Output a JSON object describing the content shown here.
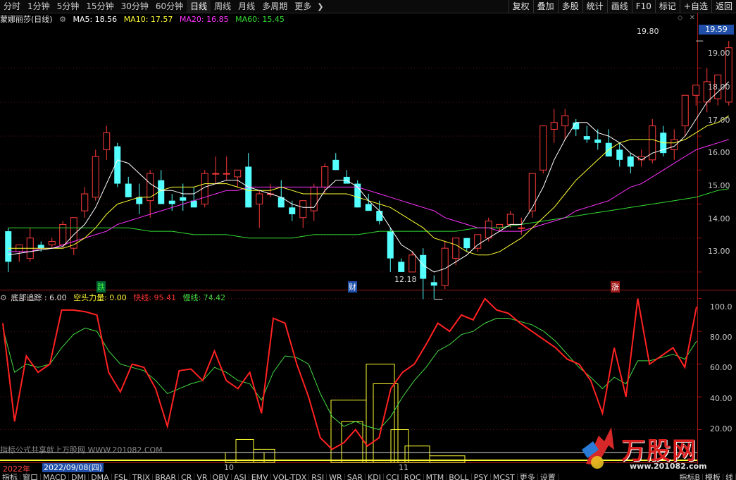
{
  "toolbar": {
    "tabs": [
      "分时",
      "1分钟",
      "5分钟",
      "15分钟",
      "30分钟",
      "60分钟",
      "日线",
      "周线",
      "月线",
      "多周期",
      "更多"
    ],
    "active_tab": "日线",
    "right_buttons": [
      "复权",
      "叠加",
      "多股",
      "统计",
      "画线",
      "F10",
      "标记",
      "+自选",
      "返回"
    ]
  },
  "main_legend": {
    "title": "蒙娜丽莎(日线)",
    "ma5": "MA5: 18.56",
    "ma10": "MA10: 17.57",
    "ma20": "MA20: 16.85",
    "ma60": "MA60: 15.45"
  },
  "sub_legend": {
    "name": "底部追踪 : 6.00",
    "kongtou": "空头力量: 0.00",
    "kuaixian": "快线: 95.41",
    "manxian": "慢线: 74.42"
  },
  "current_price": "19.59",
  "annotations": {
    "high": "19.80",
    "low": "12.18",
    "mark1": "跌",
    "mark2": "财",
    "mark3": "涨"
  },
  "price_axis": [
    "19.00",
    "18.00",
    "17.00",
    "16.00",
    "15.00",
    "14.00",
    "13.00"
  ],
  "sub_axis": [
    "100.0",
    "80.00",
    "60.00",
    "40.00",
    "20.00"
  ],
  "date_bar": {
    "year": "2022年",
    "cursor_date": "2022/09/08(四)",
    "month1": "10",
    "month2": "11"
  },
  "indicator_tabs": [
    "指标",
    "窗口",
    "MACD",
    "DMI",
    "DMA",
    "FSL",
    "TRIX",
    "BRAR",
    "CR",
    "VR",
    "OBV",
    "ASI",
    "EMV",
    "VOL-TDX",
    "RSI",
    "WR",
    "SAR",
    "KDJ",
    "CCI",
    "ROC",
    "MTM",
    "BOLL",
    "PSY",
    "MCST",
    "更多",
    "设置"
  ],
  "indicator_right": [
    "指标B",
    "模板",
    "线"
  ],
  "watermark": {
    "brand": "万股网",
    "url": "www.201082.com",
    "caption": "指标公式共享就上万股网 WWW.201082.COM"
  },
  "colors": {
    "up": "#ff3b3b",
    "down": "#54ffff",
    "ma5": "#ffffff",
    "ma10": "#ffff33",
    "ma20": "#ff33ff",
    "ma60": "#33dd33",
    "fast": "#ff2222",
    "slow": "#44dd44",
    "axis_tag": "#1f4fa8"
  },
  "chart_data": [
    {
      "type": "candlestick",
      "title": "蒙娜丽莎(日线)",
      "ylim": [
        12.5,
        20.3
      ],
      "candles": [
        [
          14.2,
          14.3,
          13.0,
          13.3
        ],
        [
          13.6,
          13.7,
          13.3,
          13.8
        ],
        [
          13.4,
          14.3,
          13.3,
          14.0
        ],
        [
          13.8,
          13.9,
          13.6,
          13.7
        ],
        [
          13.8,
          14.0,
          13.7,
          13.9
        ],
        [
          13.8,
          14.5,
          13.7,
          14.4
        ],
        [
          13.7,
          14.6,
          13.5,
          14.6
        ],
        [
          14.8,
          15.5,
          14.6,
          15.3
        ],
        [
          15.2,
          16.6,
          15.1,
          16.4
        ],
        [
          16.6,
          17.3,
          16.3,
          17.1
        ],
        [
          16.7,
          16.8,
          15.5,
          15.6
        ],
        [
          15.6,
          15.8,
          15.2,
          15.2
        ],
        [
          15.2,
          15.6,
          14.7,
          15.0
        ],
        [
          15.1,
          16.0,
          14.6,
          15.9
        ],
        [
          15.7,
          16.0,
          15.0,
          15.0
        ],
        [
          15.1,
          15.3,
          14.8,
          15.0
        ],
        [
          15.2,
          15.6,
          14.8,
          15.1
        ],
        [
          15.1,
          15.5,
          14.9,
          14.9
        ],
        [
          15.0,
          16.0,
          14.9,
          15.9
        ],
        [
          15.9,
          16.4,
          15.6,
          15.9
        ],
        [
          15.9,
          16.4,
          15.7,
          15.9
        ],
        [
          15.8,
          16.0,
          15.5,
          16.0
        ],
        [
          16.1,
          16.5,
          14.9,
          14.9
        ],
        [
          15.0,
          15.4,
          14.3,
          15.3
        ],
        [
          15.3,
          15.6,
          15.2,
          15.3
        ],
        [
          15.2,
          15.7,
          14.9,
          14.9
        ],
        [
          14.9,
          15.1,
          14.5,
          14.7
        ],
        [
          14.6,
          14.8,
          14.3,
          15.1
        ],
        [
          14.8,
          15.6,
          14.5,
          15.5
        ],
        [
          15.5,
          16.2,
          15.3,
          16.1
        ],
        [
          16.3,
          16.5,
          16.0,
          16.0
        ],
        [
          15.8,
          16.0,
          15.6,
          15.6
        ],
        [
          15.6,
          15.7,
          14.9,
          14.9
        ],
        [
          15.0,
          15.3,
          14.9,
          14.8
        ],
        [
          14.8,
          15.1,
          14.4,
          14.5
        ],
        [
          14.2,
          14.3,
          13.0,
          13.4
        ],
        [
          13.3,
          13.4,
          13.0,
          13.0
        ],
        [
          13.0,
          13.6,
          13.0,
          13.5
        ],
        [
          13.5,
          13.7,
          12.2,
          12.8
        ],
        [
          12.7,
          12.9,
          12.2,
          12.6
        ],
        [
          12.6,
          13.9,
          12.5,
          13.7
        ],
        [
          13.4,
          14.0,
          13.2,
          14.0
        ],
        [
          14.0,
          14.0,
          13.6,
          13.7
        ],
        [
          13.7,
          14.1,
          13.6,
          14.1
        ],
        [
          14.0,
          14.6,
          13.9,
          14.5
        ],
        [
          14.3,
          14.4,
          14.2,
          14.4
        ],
        [
          14.4,
          14.8,
          14.3,
          14.7
        ],
        [
          14.3,
          14.6,
          14.1,
          14.3
        ],
        [
          14.8,
          15.4,
          14.6,
          15.9
        ],
        [
          16.0,
          17.3,
          15.9,
          17.3
        ],
        [
          17.2,
          17.8,
          16.8,
          17.4
        ],
        [
          17.3,
          17.8,
          16.9,
          17.6
        ],
        [
          17.4,
          17.5,
          17.0,
          17.2
        ],
        [
          17.0,
          17.3,
          16.8,
          16.9
        ],
        [
          16.9,
          17.2,
          16.6,
          16.8
        ],
        [
          16.8,
          17.2,
          16.5,
          16.4
        ],
        [
          16.6,
          16.8,
          16.1,
          16.3
        ],
        [
          16.4,
          16.5,
          15.9,
          16.1
        ],
        [
          16.3,
          16.6,
          16.1,
          16.4
        ],
        [
          16.3,
          17.5,
          16.2,
          17.3
        ],
        [
          17.1,
          17.3,
          16.4,
          16.5
        ],
        [
          16.6,
          17.2,
          16.3,
          16.9
        ],
        [
          17.3,
          18.2,
          17.0,
          18.2
        ],
        [
          18.2,
          18.5,
          17.9,
          18.5
        ],
        [
          18.0,
          19.0,
          17.7,
          18.6
        ],
        [
          18.1,
          18.8,
          17.9,
          18.8
        ],
        [
          18.0,
          19.8,
          17.9,
          19.6
        ]
      ],
      "ma5": [
        13.5,
        13.55,
        13.6,
        13.65,
        13.7,
        13.75,
        14.1,
        14.4,
        14.9,
        15.6,
        16.3,
        16.2,
        15.9,
        15.6,
        15.4,
        15.4,
        15.3,
        15.3,
        15.5,
        15.6,
        15.7,
        15.7,
        15.5,
        15.4,
        15.3,
        15.2,
        15.0,
        14.9,
        14.9,
        15.4,
        15.7,
        15.7,
        15.5,
        15.1,
        14.8,
        14.3,
        13.8,
        13.6,
        13.2,
        13.0,
        13.1,
        13.3,
        13.5,
        13.8,
        14.0,
        14.2,
        14.4,
        14.4,
        14.9,
        15.5,
        16.3,
        16.9,
        17.4,
        17.4,
        17.1,
        17.0,
        16.8,
        16.5,
        16.3,
        16.5,
        16.6,
        16.7,
        17.0,
        17.5,
        18.0,
        18.3,
        18.6
      ],
      "ma10": [
        13.7,
        13.7,
        13.7,
        13.7,
        13.7,
        13.7,
        13.8,
        14.0,
        14.3,
        14.7,
        15.0,
        15.1,
        15.2,
        15.2,
        15.4,
        15.5,
        15.5,
        15.5,
        15.6,
        15.6,
        15.6,
        15.5,
        15.4,
        15.4,
        15.4,
        15.5,
        15.4,
        15.3,
        15.3,
        15.3,
        15.3,
        15.3,
        15.2,
        15.1,
        15.0,
        14.9,
        14.7,
        14.5,
        14.3,
        14.0,
        13.9,
        13.8,
        13.6,
        13.5,
        13.5,
        13.6,
        13.8,
        14.0,
        14.3,
        14.6,
        14.9,
        15.3,
        15.7,
        16.0,
        16.3,
        16.6,
        16.8,
        16.9,
        16.9,
        16.9,
        16.8,
        16.8,
        16.9,
        17.1,
        17.3,
        17.4,
        17.6
      ],
      "ma20": [
        13.6,
        13.6,
        13.6,
        13.7,
        13.7,
        13.8,
        13.9,
        14.0,
        14.1,
        14.2,
        14.4,
        14.5,
        14.6,
        14.7,
        14.8,
        14.9,
        15.0,
        15.1,
        15.2,
        15.3,
        15.4,
        15.4,
        15.5,
        15.5,
        15.5,
        15.5,
        15.5,
        15.5,
        15.5,
        15.5,
        15.5,
        15.5,
        15.5,
        15.4,
        15.3,
        15.2,
        15.1,
        15.0,
        14.9,
        14.8,
        14.6,
        14.5,
        14.4,
        14.3,
        14.3,
        14.2,
        14.2,
        14.2,
        14.3,
        14.4,
        14.5,
        14.6,
        14.8,
        14.9,
        15.0,
        15.1,
        15.3,
        15.5,
        15.6,
        15.8,
        16.0,
        16.2,
        16.4,
        16.6,
        16.7,
        16.8,
        16.9
      ],
      "ma60": [
        14.3,
        14.3,
        14.3,
        14.3,
        14.3,
        14.3,
        14.3,
        14.3,
        14.3,
        14.3,
        14.3,
        14.3,
        14.25,
        14.2,
        14.2,
        14.2,
        14.15,
        14.1,
        14.1,
        14.1,
        14.1,
        14.05,
        14.0,
        14.0,
        14.0,
        14.0,
        14.0,
        14.05,
        14.1,
        14.1,
        14.1,
        14.1,
        14.1,
        14.15,
        14.2,
        14.2,
        14.2,
        14.2,
        14.2,
        14.2,
        14.2,
        14.2,
        14.25,
        14.3,
        14.3,
        14.3,
        14.35,
        14.4,
        14.45,
        14.5,
        14.55,
        14.6,
        14.65,
        14.7,
        14.75,
        14.8,
        14.85,
        14.9,
        14.95,
        15.0,
        15.05,
        15.1,
        15.15,
        15.2,
        15.3,
        15.4,
        15.45
      ]
    },
    {
      "type": "line",
      "title": "底部追踪",
      "ylim": [
        0,
        105
      ],
      "series": [
        {
          "name": "快线",
          "values": [
            85,
            25,
            65,
            55,
            60,
            93,
            93,
            92,
            90,
            55,
            43,
            60,
            58,
            45,
            22,
            56,
            57,
            50,
            68,
            50,
            45,
            55,
            30,
            88,
            85,
            60,
            40,
            15,
            8,
            12,
            20,
            10,
            15,
            45,
            55,
            60,
            72,
            85,
            80,
            90,
            87,
            100,
            93,
            91,
            85,
            80,
            75,
            70,
            63,
            60,
            50,
            30,
            70,
            40,
            100,
            60,
            65,
            70,
            58,
            95
          ]
        },
        {
          "name": "慢线",
          "values": [
            82,
            55,
            60,
            58,
            60,
            70,
            78,
            82,
            80,
            68,
            60,
            58,
            56,
            50,
            42,
            45,
            48,
            50,
            58,
            55,
            50,
            48,
            38,
            55,
            65,
            64,
            60,
            42,
            28,
            22,
            25,
            22,
            20,
            28,
            40,
            50,
            58,
            68,
            72,
            78,
            80,
            85,
            88,
            88,
            86,
            84,
            80,
            74,
            66,
            58,
            52,
            45,
            52,
            48,
            62,
            62,
            64,
            66,
            63,
            74
          ]
        }
      ]
    }
  ]
}
